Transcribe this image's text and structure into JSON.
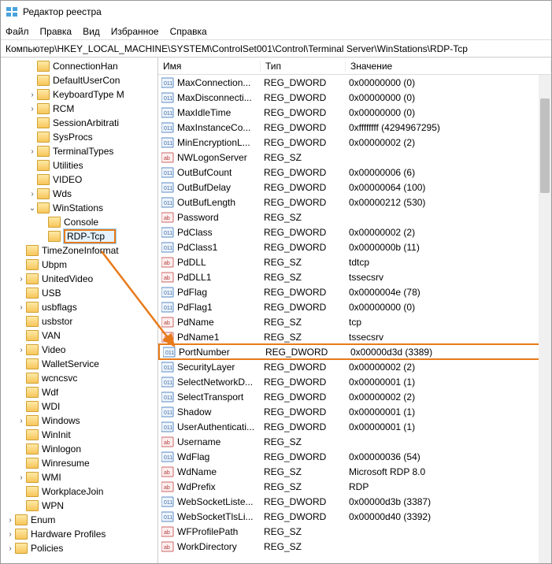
{
  "titlebar": {
    "title": "Редактор реестра"
  },
  "menu": [
    "Файл",
    "Правка",
    "Вид",
    "Избранное",
    "Справка"
  ],
  "address": "Компьютер\\HKEY_LOCAL_MACHINE\\SYSTEM\\ControlSet001\\Control\\Terminal Server\\WinStations\\RDP-Tcp",
  "columns": {
    "name": "Имя",
    "type": "Тип",
    "value": "Значение"
  },
  "tree": [
    {
      "indent": 2,
      "exp": "",
      "label": "ConnectionHan"
    },
    {
      "indent": 2,
      "exp": "",
      "label": "DefaultUserCon"
    },
    {
      "indent": 2,
      "exp": ">",
      "label": "KeyboardType M"
    },
    {
      "indent": 2,
      "exp": ">",
      "label": "RCM"
    },
    {
      "indent": 2,
      "exp": "",
      "label": "SessionArbitrati"
    },
    {
      "indent": 2,
      "exp": "",
      "label": "SysProcs"
    },
    {
      "indent": 2,
      "exp": ">",
      "label": "TerminalTypes"
    },
    {
      "indent": 2,
      "exp": "",
      "label": "Utilities"
    },
    {
      "indent": 2,
      "exp": "",
      "label": "VIDEO"
    },
    {
      "indent": 2,
      "exp": ">",
      "label": "Wds"
    },
    {
      "indent": 2,
      "exp": "v",
      "label": "WinStations"
    },
    {
      "indent": 3,
      "exp": "",
      "label": "Console"
    },
    {
      "indent": 3,
      "exp": "",
      "label": "RDP-Tcp",
      "selected": true,
      "boxed": true
    },
    {
      "indent": 1,
      "exp": "",
      "label": "TimeZoneInformat"
    },
    {
      "indent": 1,
      "exp": "",
      "label": "Ubpm"
    },
    {
      "indent": 1,
      "exp": ">",
      "label": "UnitedVideo"
    },
    {
      "indent": 1,
      "exp": "",
      "label": "USB"
    },
    {
      "indent": 1,
      "exp": ">",
      "label": "usbflags"
    },
    {
      "indent": 1,
      "exp": "",
      "label": "usbstor"
    },
    {
      "indent": 1,
      "exp": "",
      "label": "VAN"
    },
    {
      "indent": 1,
      "exp": ">",
      "label": "Video"
    },
    {
      "indent": 1,
      "exp": "",
      "label": "WalletService"
    },
    {
      "indent": 1,
      "exp": "",
      "label": "wcncsvc"
    },
    {
      "indent": 1,
      "exp": "",
      "label": "Wdf"
    },
    {
      "indent": 1,
      "exp": "",
      "label": "WDI"
    },
    {
      "indent": 1,
      "exp": ">",
      "label": "Windows"
    },
    {
      "indent": 1,
      "exp": "",
      "label": "WinInit"
    },
    {
      "indent": 1,
      "exp": "",
      "label": "Winlogon"
    },
    {
      "indent": 1,
      "exp": "",
      "label": "Winresume"
    },
    {
      "indent": 1,
      "exp": ">",
      "label": "WMI"
    },
    {
      "indent": 1,
      "exp": "",
      "label": "WorkplaceJoin"
    },
    {
      "indent": 1,
      "exp": "",
      "label": "WPN"
    },
    {
      "indent": 0,
      "exp": ">",
      "label": "Enum"
    },
    {
      "indent": 0,
      "exp": ">",
      "label": "Hardware Profiles"
    },
    {
      "indent": 0,
      "exp": ">",
      "label": "Policies"
    }
  ],
  "values": [
    {
      "icon": "dw",
      "name": "MaxConnection...",
      "type": "REG_DWORD",
      "val": "0x00000000 (0)"
    },
    {
      "icon": "dw",
      "name": "MaxDisconnecti...",
      "type": "REG_DWORD",
      "val": "0x00000000 (0)"
    },
    {
      "icon": "dw",
      "name": "MaxIdleTime",
      "type": "REG_DWORD",
      "val": "0x00000000 (0)"
    },
    {
      "icon": "dw",
      "name": "MaxInstanceCo...",
      "type": "REG_DWORD",
      "val": "0xffffffff (4294967295)"
    },
    {
      "icon": "dw",
      "name": "MinEncryptionL...",
      "type": "REG_DWORD",
      "val": "0x00000002 (2)"
    },
    {
      "icon": "sz",
      "name": "NWLogonServer",
      "type": "REG_SZ",
      "val": ""
    },
    {
      "icon": "dw",
      "name": "OutBufCount",
      "type": "REG_DWORD",
      "val": "0x00000006 (6)"
    },
    {
      "icon": "dw",
      "name": "OutBufDelay",
      "type": "REG_DWORD",
      "val": "0x00000064 (100)"
    },
    {
      "icon": "dw",
      "name": "OutBufLength",
      "type": "REG_DWORD",
      "val": "0x00000212 (530)"
    },
    {
      "icon": "sz",
      "name": "Password",
      "type": "REG_SZ",
      "val": ""
    },
    {
      "icon": "dw",
      "name": "PdClass",
      "type": "REG_DWORD",
      "val": "0x00000002 (2)"
    },
    {
      "icon": "dw",
      "name": "PdClass1",
      "type": "REG_DWORD",
      "val": "0x0000000b (11)"
    },
    {
      "icon": "sz",
      "name": "PdDLL",
      "type": "REG_SZ",
      "val": "tdtcp"
    },
    {
      "icon": "sz",
      "name": "PdDLL1",
      "type": "REG_SZ",
      "val": "tssecsrv"
    },
    {
      "icon": "dw",
      "name": "PdFlag",
      "type": "REG_DWORD",
      "val": "0x0000004e (78)"
    },
    {
      "icon": "dw",
      "name": "PdFlag1",
      "type": "REG_DWORD",
      "val": "0x00000000 (0)"
    },
    {
      "icon": "sz",
      "name": "PdName",
      "type": "REG_SZ",
      "val": "tcp"
    },
    {
      "icon": "sz",
      "name": "PdName1",
      "type": "REG_SZ",
      "val": "tssecsrv"
    },
    {
      "icon": "dw",
      "name": "PortNumber",
      "type": "REG_DWORD",
      "val": "0x00000d3d (3389)",
      "hl": true
    },
    {
      "icon": "dw",
      "name": "SecurityLayer",
      "type": "REG_DWORD",
      "val": "0x00000002 (2)"
    },
    {
      "icon": "dw",
      "name": "SelectNetworkD...",
      "type": "REG_DWORD",
      "val": "0x00000001 (1)"
    },
    {
      "icon": "dw",
      "name": "SelectTransport",
      "type": "REG_DWORD",
      "val": "0x00000002 (2)"
    },
    {
      "icon": "dw",
      "name": "Shadow",
      "type": "REG_DWORD",
      "val": "0x00000001 (1)"
    },
    {
      "icon": "dw",
      "name": "UserAuthenticati...",
      "type": "REG_DWORD",
      "val": "0x00000001 (1)"
    },
    {
      "icon": "sz",
      "name": "Username",
      "type": "REG_SZ",
      "val": ""
    },
    {
      "icon": "dw",
      "name": "WdFlag",
      "type": "REG_DWORD",
      "val": "0x00000036 (54)"
    },
    {
      "icon": "sz",
      "name": "WdName",
      "type": "REG_SZ",
      "val": "Microsoft RDP 8.0"
    },
    {
      "icon": "sz",
      "name": "WdPrefix",
      "type": "REG_SZ",
      "val": "RDP"
    },
    {
      "icon": "dw",
      "name": "WebSocketListe...",
      "type": "REG_DWORD",
      "val": "0x00000d3b (3387)"
    },
    {
      "icon": "dw",
      "name": "WebSocketTlsLi...",
      "type": "REG_DWORD",
      "val": "0x00000d40 (3392)"
    },
    {
      "icon": "sz",
      "name": "WFProfilePath",
      "type": "REG_SZ",
      "val": ""
    },
    {
      "icon": "sz",
      "name": "WorkDirectory",
      "type": "REG_SZ",
      "val": ""
    }
  ]
}
